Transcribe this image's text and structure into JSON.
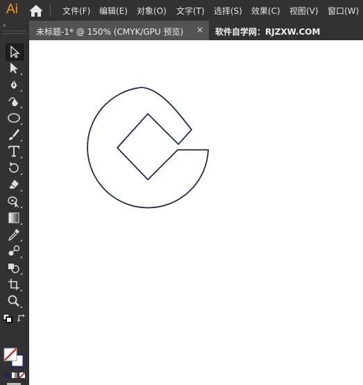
{
  "app": {
    "logo_text": "Ai"
  },
  "menus": [
    "文件(F)",
    "编辑(E)",
    "对象(O)",
    "文字(T)",
    "选择(S)",
    "效果(C)",
    "视图(V)",
    "窗口(W)"
  ],
  "tabs": [
    {
      "label": "未标题-1* @ 150% (CMYK/GPU 预览)",
      "close": "×"
    },
    {
      "label": "软件自学网：RJZXW.COM"
    }
  ],
  "toolbar": {
    "collapse": "»",
    "tools": [
      "selection-tool",
      "direct-selection-tool",
      "pen-tool",
      "curvature-tool",
      "ellipse-tool",
      "paintbrush-tool",
      "type-tool",
      "rotate-tool",
      "eraser-tool",
      "puppet-warp-tool",
      "gradient-tool",
      "eyedropper-tool",
      "blend-tool",
      "shape-builder-tool",
      "artboard-tool",
      "zoom-tool"
    ]
  },
  "colors": {
    "stroke": "#1f2a55",
    "accent": "#ff9a00",
    "chrome": "#323232",
    "panel": "#535353"
  }
}
